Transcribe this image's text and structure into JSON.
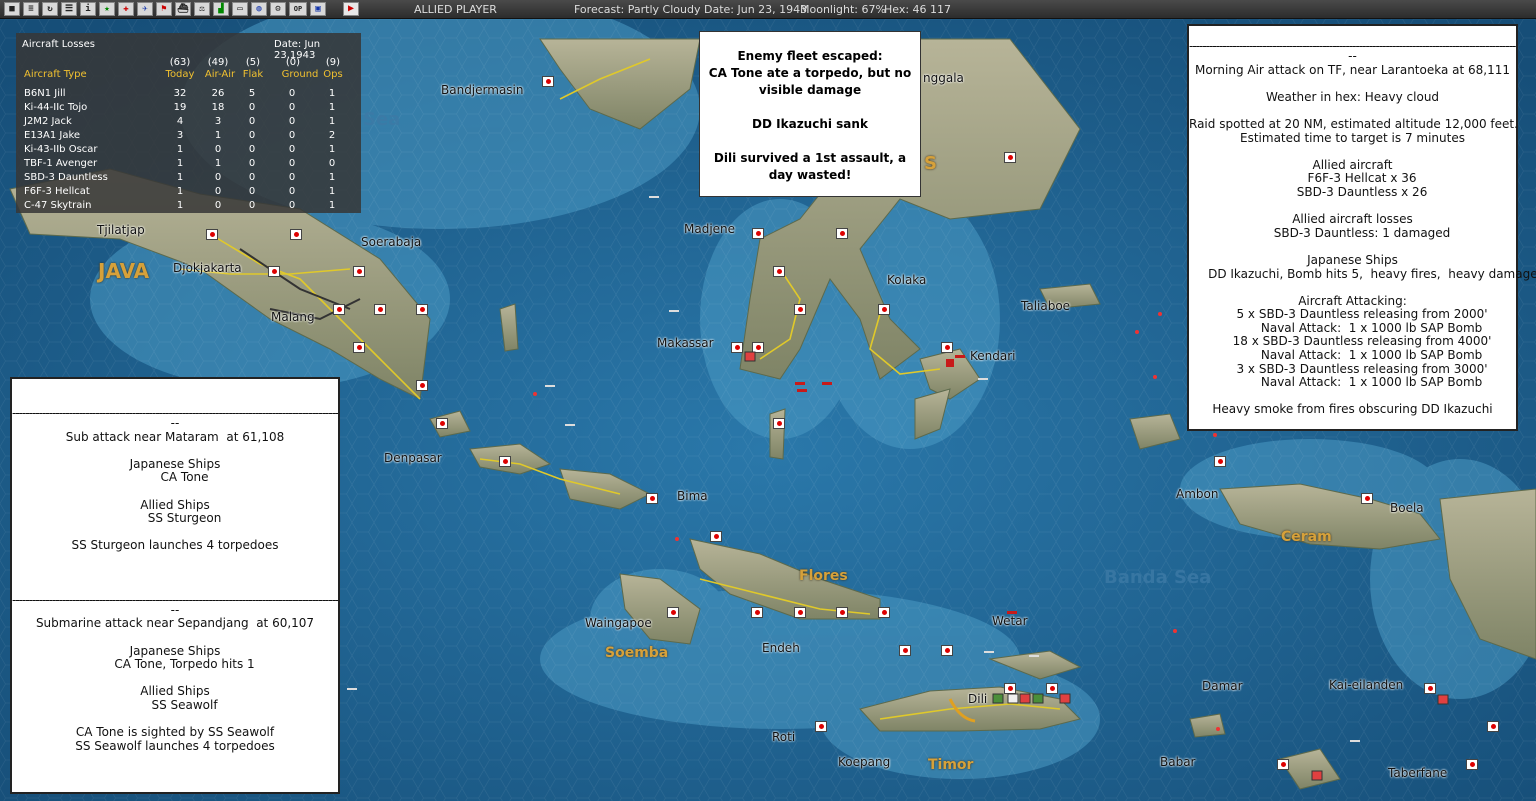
{
  "toolbar": {
    "buttons": [
      "square-icon",
      "document-icon",
      "refresh-icon",
      "list-icon",
      "info-icon",
      "star-icon",
      "medic-icon",
      "plane-icon",
      "flag-icon",
      "ship-icon",
      "scale-icon",
      "chart-icon",
      "bar-icon",
      "globe-icon",
      "gear-icon",
      "op-icon",
      "screen-icon",
      "play-icon"
    ],
    "op_label": "OP",
    "player": "ALLIED PLAYER",
    "forecast": "Forecast: Partly Cloudy",
    "date": "Date: Jun 23, 1943",
    "moonlight": "Moonlight: 67%",
    "hex": "Hex: 46 117"
  },
  "map": {
    "places": [
      {
        "name": "Bandjermasin"
      },
      {
        "name": "Tjilatjap"
      },
      {
        "name": "Djokjakarta"
      },
      {
        "name": "Soerabaja"
      },
      {
        "name": "Malang"
      },
      {
        "name": "Denpasar"
      },
      {
        "name": "Madjene"
      },
      {
        "name": "Makassar"
      },
      {
        "name": "Kolaka"
      },
      {
        "name": "Kendari"
      },
      {
        "name": "Taliaboe"
      },
      {
        "name": "Bima"
      },
      {
        "name": "Ambon"
      },
      {
        "name": "Boela"
      },
      {
        "name": "Waingapoe"
      },
      {
        "name": "Endeh"
      },
      {
        "name": "Wetar"
      },
      {
        "name": "Dili"
      },
      {
        "name": "Damar"
      },
      {
        "name": "Kai-eilanden"
      },
      {
        "name": "Roti"
      },
      {
        "name": "Koepang"
      },
      {
        "name": "Babar"
      },
      {
        "name": "Taberfane"
      },
      {
        "name": "nggala"
      }
    ],
    "regions": [
      "JAVA",
      "Flores",
      "Soemba",
      "Timor",
      "Ceram",
      "S"
    ],
    "seas": [
      "Sea",
      "Banda Sea"
    ]
  },
  "aircraft_losses": {
    "title": "Aircraft Losses",
    "date": "Date: Jun 23,1943",
    "totals": [
      "(63)",
      "(49)",
      "(5)",
      "(0)",
      "(9)"
    ],
    "columns": [
      "Aircraft Type",
      "Today",
      "Air-Air",
      "Flak",
      "Ground",
      "Ops"
    ],
    "rows": [
      {
        "type": "B6N1 Jill",
        "today": "32",
        "air": "26",
        "flak": "5",
        "ground": "0",
        "ops": "1"
      },
      {
        "type": "Ki-44-IIc Tojo",
        "today": "19",
        "air": "18",
        "flak": "0",
        "ground": "0",
        "ops": "1"
      },
      {
        "type": "J2M2 Jack",
        "today": "4",
        "air": "3",
        "flak": "0",
        "ground": "0",
        "ops": "1"
      },
      {
        "type": "E13A1 Jake",
        "today": "3",
        "air": "1",
        "flak": "0",
        "ground": "0",
        "ops": "2"
      },
      {
        "type": "Ki-43-IIb Oscar",
        "today": "1",
        "air": "0",
        "flak": "0",
        "ground": "0",
        "ops": "1"
      },
      {
        "type": "TBF-1 Avenger",
        "today": "1",
        "air": "1",
        "flak": "0",
        "ground": "0",
        "ops": "0"
      },
      {
        "type": "SBD-3 Dauntless",
        "today": "1",
        "air": "0",
        "flak": "0",
        "ground": "0",
        "ops": "1"
      },
      {
        "type": "F6F-3 Hellcat",
        "today": "1",
        "air": "0",
        "flak": "0",
        "ground": "0",
        "ops": "1"
      },
      {
        "type": "C-47 Skytrain",
        "today": "1",
        "air": "0",
        "flak": "0",
        "ground": "0",
        "ops": "1"
      }
    ]
  },
  "fleet_message": {
    "lines": [
      "Enemy fleet escaped:",
      "CA Tone ate a torpedo, but no",
      "visible damage",
      "",
      "DD Ikazuchi sank",
      "",
      "Dili survived a 1st assault, a",
      "day wasted!"
    ]
  },
  "left_report": {
    "lines": [
      "--",
      "Sub attack near Mataram  at 61,108",
      "",
      "Japanese Ships",
      "     CA Tone",
      "",
      "Allied Ships",
      "     SS Sturgeon",
      "",
      "SS Sturgeon launches 4 torpedoes",
      "",
      "",
      "",
      "--",
      "Submarine attack near Sepandjang  at 60,107",
      "",
      "Japanese Ships",
      "     CA Tone, Torpedo hits 1",
      "",
      "Allied Ships",
      "     SS Seawolf",
      "",
      "CA Tone is sighted by SS Seawolf",
      "SS Seawolf launches 4 torpedoes"
    ]
  },
  "right_report": {
    "lines": [
      "--",
      "Morning Air attack on TF, near Larantoeka at 68,111",
      "",
      "Weather in hex: Heavy cloud",
      "",
      "Raid spotted at 20 NM, estimated altitude 12,000 feet.",
      "Estimated time to target is 7 minutes",
      "",
      "Allied aircraft",
      "     F6F-3 Hellcat x 36",
      "     SBD-3 Dauntless x 26",
      "",
      "Allied aircraft losses",
      "     SBD-3 Dauntless: 1 damaged",
      "",
      "Japanese Ships",
      "     DD Ikazuchi, Bomb hits 5,  heavy fires,  heavy damage",
      "",
      "Aircraft Attacking:",
      "     5 x SBD-3 Dauntless releasing from 2000'",
      "          Naval Attack:  1 x 1000 lb SAP Bomb",
      "     18 x SBD-3 Dauntless releasing from 4000'",
      "          Naval Attack:  1 x 1000 lb SAP Bomb",
      "     3 x SBD-3 Dauntless releasing from 3000'",
      "          Naval Attack:  1 x 1000 lb SAP Bomb",
      "",
      "Heavy smoke from fires obscuring DD Ikazuchi"
    ]
  }
}
